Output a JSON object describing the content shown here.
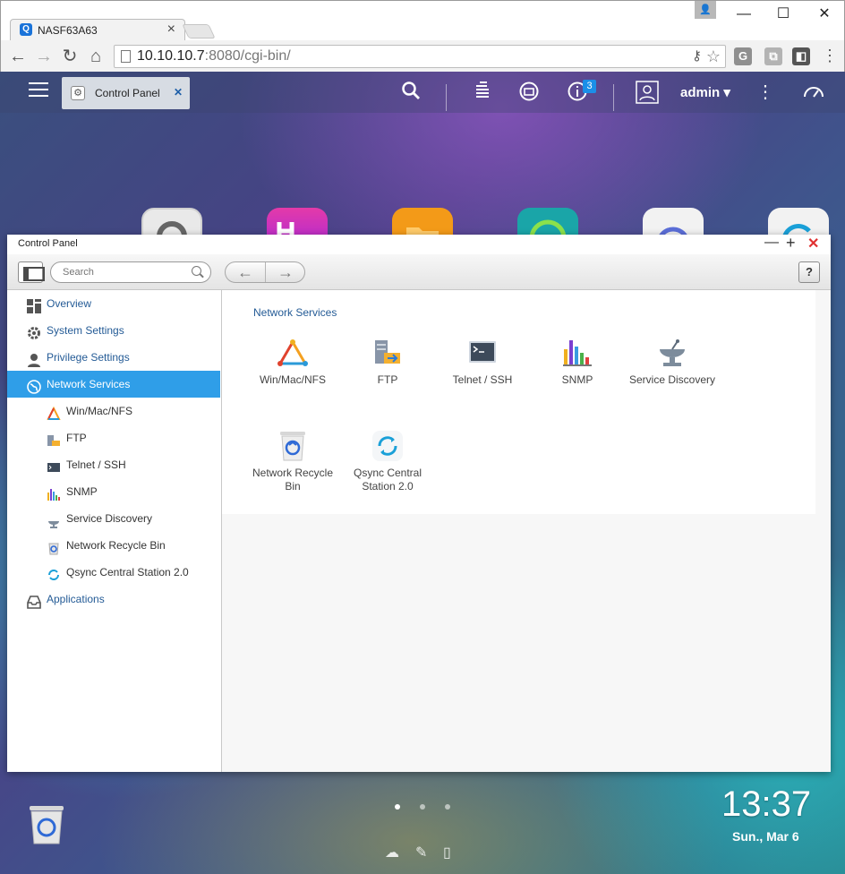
{
  "browser": {
    "tab_title": "NASF63A63",
    "tab_close": "×",
    "tab_favicon": "Q",
    "url_host": "10.10.10.7",
    "url_rest": ":8080/cgi-bin/",
    "window_buttons": [
      "—",
      "☐",
      "✕"
    ]
  },
  "qts": {
    "taskbar_tab": "Control Panel",
    "notification_count": "3",
    "user": "admin"
  },
  "window": {
    "title": "Control Panel",
    "search_placeholder": "Search",
    "help": "?"
  },
  "sidebar": {
    "items": [
      {
        "label": "Overview",
        "icon": "overview-icon"
      },
      {
        "label": "System Settings",
        "icon": "gear-icon"
      },
      {
        "label": "Privilege Settings",
        "icon": "user-icon"
      },
      {
        "label": "Network Services",
        "icon": "globe-icon",
        "active": true
      },
      {
        "label": "Win/Mac/NFS",
        "icon": "triangle-icon",
        "sub": true
      },
      {
        "label": "FTP",
        "icon": "ftp-icon",
        "sub": true
      },
      {
        "label": "Telnet / SSH",
        "icon": "terminal-icon",
        "sub": true
      },
      {
        "label": "SNMP",
        "icon": "bar-chart-icon",
        "sub": true
      },
      {
        "label": "Service Discovery",
        "icon": "satellite-icon",
        "sub": true
      },
      {
        "label": "Network Recycle Bin",
        "icon": "recycle-icon",
        "sub": true
      },
      {
        "label": "Qsync Central Station 2.0",
        "icon": "sync-icon",
        "sub": true
      },
      {
        "label": "Applications",
        "icon": "applications-icon"
      }
    ]
  },
  "main": {
    "section_title": "Network Services",
    "apps": [
      {
        "label": "Win/Mac/NFS",
        "icon": "triangle-icon"
      },
      {
        "label": "FTP",
        "icon": "ftp-icon"
      },
      {
        "label": "Telnet / SSH",
        "icon": "terminal-icon"
      },
      {
        "label": "SNMP",
        "icon": "bar-chart-icon"
      },
      {
        "label": "Service Discovery",
        "icon": "satellite-icon"
      },
      {
        "label": "Network Recycle Bin",
        "icon": "recycle-icon"
      },
      {
        "label": "Qsync Central Station 2.0",
        "icon": "sync-icon"
      }
    ]
  },
  "desktop": {
    "clock": "13:37",
    "date": "Sun., Mar 6"
  },
  "colors": {
    "accent": "#2f9ee8",
    "link": "#245b96"
  }
}
